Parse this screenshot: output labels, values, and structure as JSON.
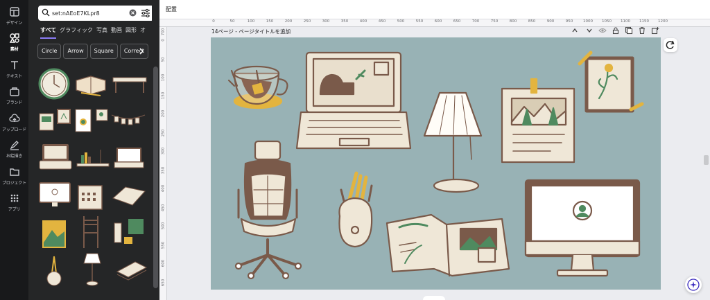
{
  "rail": [
    {
      "label": "デザイン",
      "icon": "layout-icon"
    },
    {
      "label": "素材",
      "icon": "shapes-icon",
      "active": true
    },
    {
      "label": "テキスト",
      "icon": "text-icon"
    },
    {
      "label": "ブランド",
      "icon": "brand-icon"
    },
    {
      "label": "アップロード",
      "icon": "upload-icon"
    },
    {
      "label": "お絵描き",
      "icon": "draw-icon"
    },
    {
      "label": "プロジェクト",
      "icon": "folder-icon"
    },
    {
      "label": "アプリ",
      "icon": "apps-icon"
    }
  ],
  "search": {
    "value": "set:nAEoE7KLpr8",
    "placeholder": ""
  },
  "tabs": [
    "すべて",
    "グラフィック",
    "写真",
    "動画",
    "図形",
    "オ"
  ],
  "chips": [
    "Circle",
    "Arrow",
    "Square",
    "Correct"
  ],
  "topbar": {
    "title": "配置"
  },
  "ruler": {
    "top": [
      "0",
      "50",
      "100",
      "150",
      "200",
      "250",
      "300",
      "350",
      "400",
      "450",
      "500",
      "550",
      "600",
      "650",
      "700",
      "750",
      "800",
      "850",
      "900",
      "950",
      "1000",
      "1050",
      "1100",
      "1150",
      "1200"
    ],
    "left": [
      "700",
      "0",
      "50",
      "100",
      "150",
      "200",
      "250",
      "300",
      "350",
      "400",
      "450",
      "500",
      "550",
      "600",
      "650"
    ]
  },
  "page": {
    "title": "14ページ - ページタイトルを追加"
  },
  "colors": {
    "canvas": "#98b2b5",
    "outline": "#7a5a4a",
    "cream": "#efe7d7",
    "mustard": "#e3b43f",
    "green": "#4f8a5f",
    "accent": "#8b7cf6"
  }
}
